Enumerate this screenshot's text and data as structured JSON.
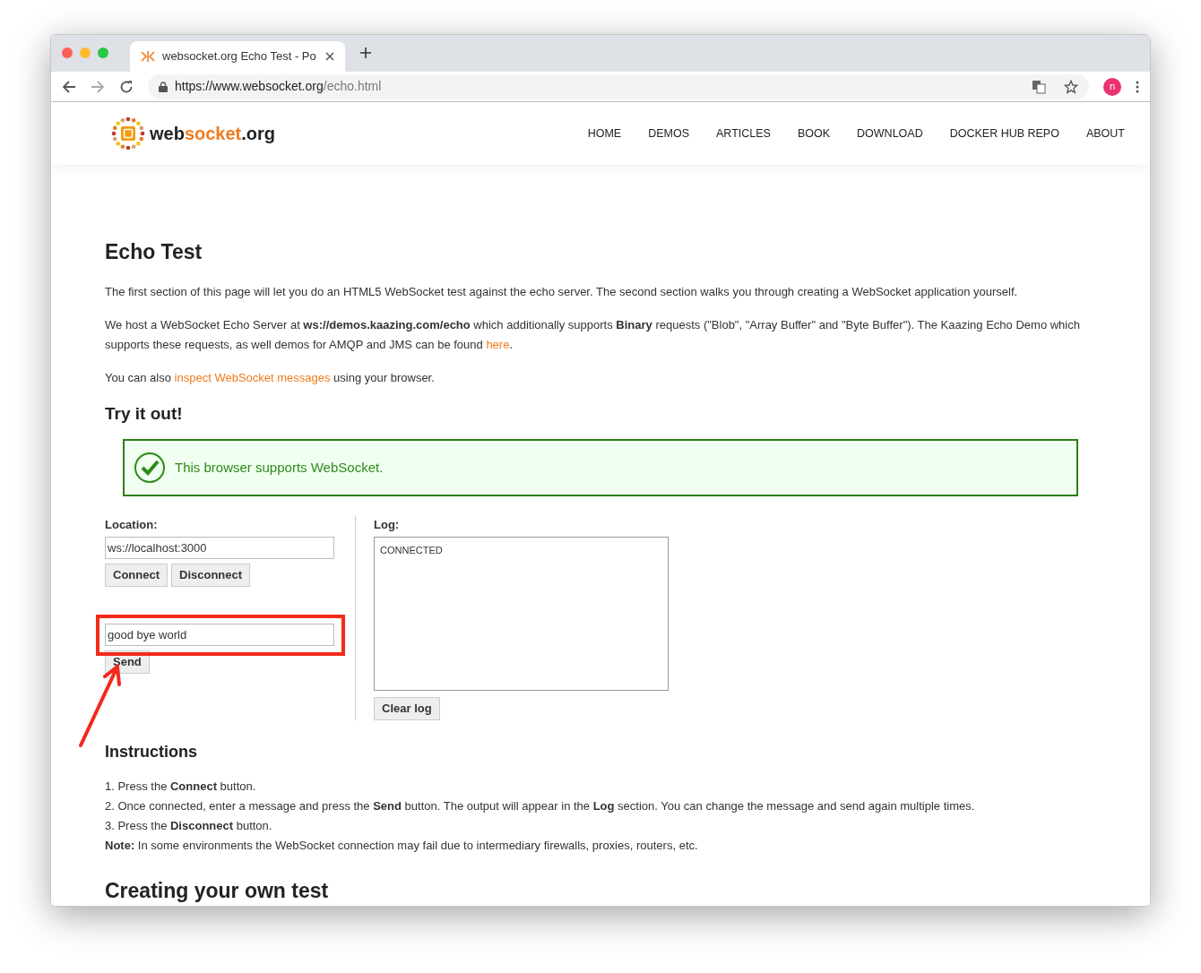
{
  "browser": {
    "tab_title": "websocket.org Echo Test - Po",
    "url_host": "https://www.websocket.org",
    "url_path": "/echo.html",
    "profile_initial": "n"
  },
  "site": {
    "logo_parts": [
      "web",
      "socket",
      ".org"
    ],
    "nav": [
      "HOME",
      "DEMOS",
      "ARTICLES",
      "BOOK",
      "DOWNLOAD",
      "DOCKER HUB REPO",
      "ABOUT"
    ]
  },
  "title": "Echo Test",
  "intro": "The first section of this page will let you do an HTML5 WebSocket test against the echo server. The second section walks you through creating a WebSocket application yourself.",
  "host_text": {
    "before": "We host a WebSocket Echo Server at **ws://demos.kaazing.com/echo** which additionally supports **Binary** requests (\"Blob\", \"Array Buffer\" and \"Byte Buffer\"). The Kaazing Echo Demo which supports these requests, as well demos for AMQP and JMS can be found ",
    "link": "here",
    "after": "."
  },
  "inspect_text": {
    "before": "You can also ",
    "link": "inspect WebSocket messages",
    "after": " using your browser."
  },
  "try_heading": "Try it out!",
  "support_message": "This browser supports WebSocket.",
  "location": {
    "label": "Location:",
    "value": "ws://localhost:3000"
  },
  "connect_buttons": [
    "Connect",
    "Disconnect"
  ],
  "message": {
    "value": "good bye world"
  },
  "send_button": "Send",
  "log": {
    "label": "Log:",
    "lines": [
      "CONNECTED"
    ]
  },
  "clear_button": "Clear log",
  "instructions_heading": "Instructions",
  "instructions": [
    "1. Press the **Connect** button.",
    "2. Once connected, enter a message and press the **Send** button. The output will appear in the **Log** section. You can change the message and send again multiple times.",
    "3. Press the **Disconnect** button.",
    "**Note:** In some environments the WebSocket connection may fail due to intermediary firewalls, proxies, routers, etc."
  ],
  "creating_heading": "Creating your own test"
}
